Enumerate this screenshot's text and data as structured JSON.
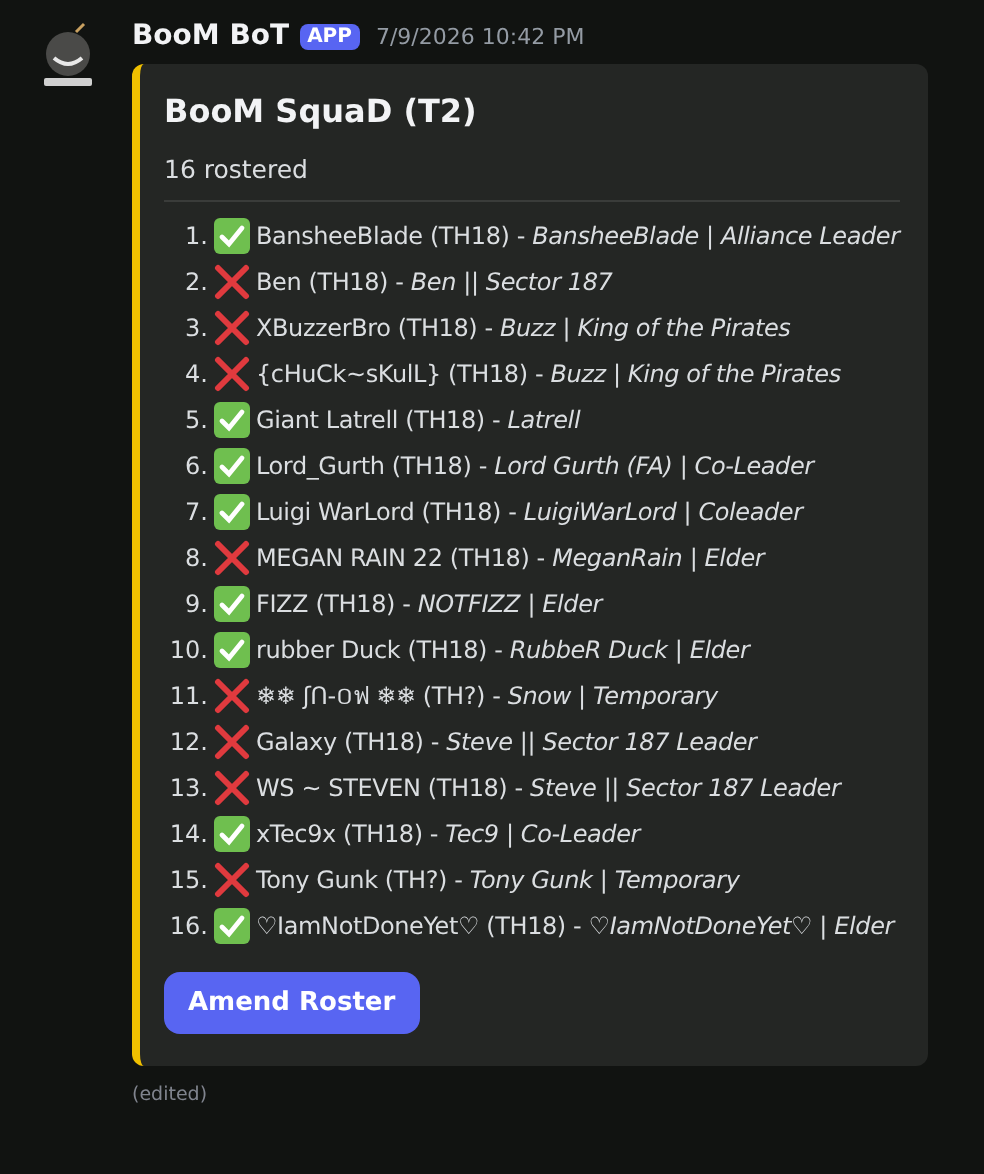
{
  "message": {
    "author": "BooM BoT",
    "badge": "APP",
    "timestamp": "7/9/2026 10:42 PM",
    "edited": "(edited)"
  },
  "embed": {
    "title": "BooM SquaD (T2)",
    "subtitle": "16 rostered",
    "entries": [
      {
        "number": "1.",
        "checked": true,
        "text": "BansheeBlade (TH18) - *BansheeBlade | Alliance Leader*"
      },
      {
        "number": "2.",
        "checked": false,
        "text": "Ben (TH18) - *Ben || Sector 187*"
      },
      {
        "number": "3.",
        "checked": false,
        "text": "XBuzzerBro (TH18) - *Buzz | King of the Pirates*"
      },
      {
        "number": "4.",
        "checked": false,
        "text": "{cHuCk~sKulL} (TH18) - *Buzz | King of the Pirates*"
      },
      {
        "number": "5.",
        "checked": true,
        "text": "Giant Latrell (TH18) - *Latrell*"
      },
      {
        "number": "6.",
        "checked": true,
        "text": "Lord_Gurth (TH18) - *Lord Gurth (FA) | Co-Leader*"
      },
      {
        "number": "7.",
        "checked": true,
        "text": "Luigi WarLord (TH18) - *LuigiWarLord | Coleader*"
      },
      {
        "number": "8.",
        "checked": false,
        "text": "MEGAN RAIN 22 (TH18) - *MeganRain | Elder*"
      },
      {
        "number": "9.",
        "checked": true,
        "text": "FIZZ (TH18) - *NOTFIZZ | Elder*"
      },
      {
        "number": "10.",
        "checked": true,
        "text": "rubber Duck (TH18) - *RubbeR Duck | Elder*"
      },
      {
        "number": "11.",
        "checked": false,
        "text": "❄❄ ʃՈ-០ฟ ❄❄ (TH?) - *Snow | Temporary*"
      },
      {
        "number": "12.",
        "checked": false,
        "text": "Galaxy (TH18) - *Steve || Sector 187 Leader*"
      },
      {
        "number": "13.",
        "checked": false,
        "text": "WS ~ STEVEN (TH18) - *Steve || Sector 187 Leader*"
      },
      {
        "number": "14.",
        "checked": true,
        "text": "xTec9x (TH18) - *Tec9 | Co-Leader*"
      },
      {
        "number": "15.",
        "checked": false,
        "text": "Tony Gunk (TH?) - *Tony Gunk | Temporary*"
      },
      {
        "number": "16.",
        "checked": true,
        "text": "♡IamNotDoneYet♡ (TH18) - *♡IamNotDoneYet♡ | Elder*"
      }
    ],
    "button": "Amend Roster"
  }
}
